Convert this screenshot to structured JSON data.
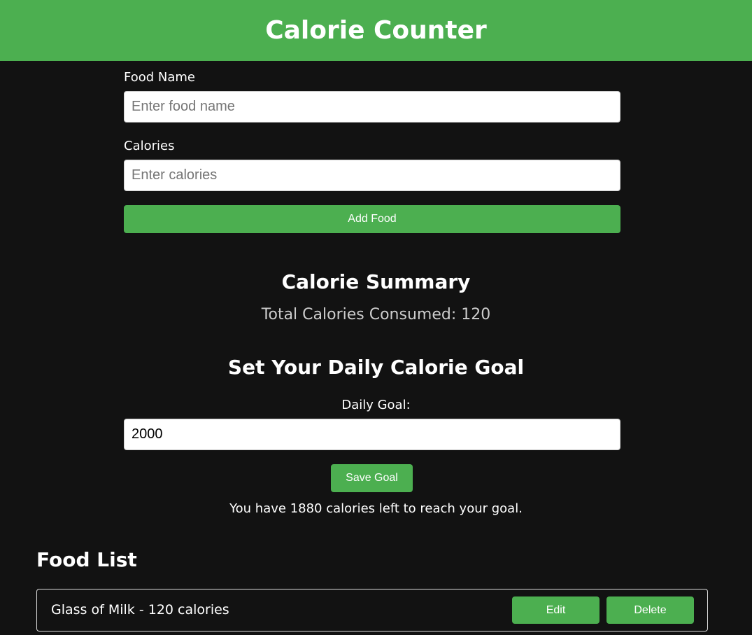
{
  "header": {
    "title": "Calorie Counter"
  },
  "form": {
    "food_name_label": "Food Name",
    "food_name_placeholder": "Enter food name",
    "calories_label": "Calories",
    "calories_placeholder": "Enter calories",
    "add_button": "Add Food"
  },
  "summary": {
    "title": "Calorie Summary",
    "total_text": "Total Calories Consumed: 120"
  },
  "goal": {
    "title": "Set Your Daily Calorie Goal",
    "label": "Daily Goal:",
    "value": "2000",
    "save_button": "Save Goal",
    "remaining_text": "You have 1880 calories left to reach your goal."
  },
  "food_list": {
    "title": "Food List",
    "items": [
      {
        "text": "Glass of Milk - 120 calories",
        "edit": "Edit",
        "delete": "Delete"
      }
    ]
  },
  "colors": {
    "accent": "#4caf50",
    "background": "#121212"
  }
}
